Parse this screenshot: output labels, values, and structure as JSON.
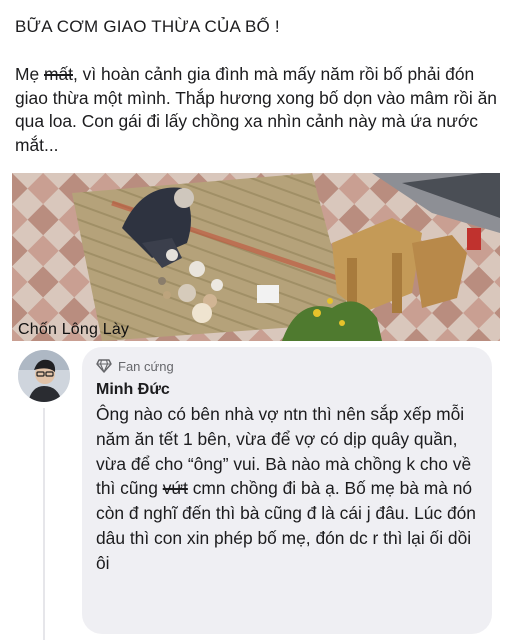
{
  "post": {
    "title": "BỮA CƠM GIAO THỪA CỦA BỐ !",
    "body_before_strike": "Mẹ ",
    "body_strike": "mất",
    "body_after_strike": ", vì hoàn cảnh gia đình mà mấy năm rồi bố phải đón giao thừa một mình. Thắp hương xong bố dọn vào mâm rồi ăn qua loa. Con gái đi lấy chồng xa nhìn cảnh này mà ứa nước mắt...",
    "image_watermark": "Chốn Lông Lày"
  },
  "comment": {
    "badge_label": "Fan cứng",
    "badge_icon": "diamond-icon",
    "author": "Minh Đức",
    "text_before_strike": "Ông nào có bên nhà vợ ntn thì nên sắp xếp mỗi năm ăn tết 1 bên, vừa để vợ có dịp quây quần, vừa để cho “ông” vui. Bà nào mà chồng k cho về thì cũng ",
    "text_strike": "vứt",
    "text_after_strike": " cmn chồng đi bà ạ. Bố mẹ bà mà nó còn đ nghĩ đến thì bà cũng đ là cái j đâu. Lúc đón dâu thì con xin phép bố mẹ, đón dc r thì lại ối dồi ôi"
  },
  "colors": {
    "background": "#ffffff",
    "bubble": "#efeff3",
    "text": "#1c1c1e",
    "muted": "#66676b"
  }
}
